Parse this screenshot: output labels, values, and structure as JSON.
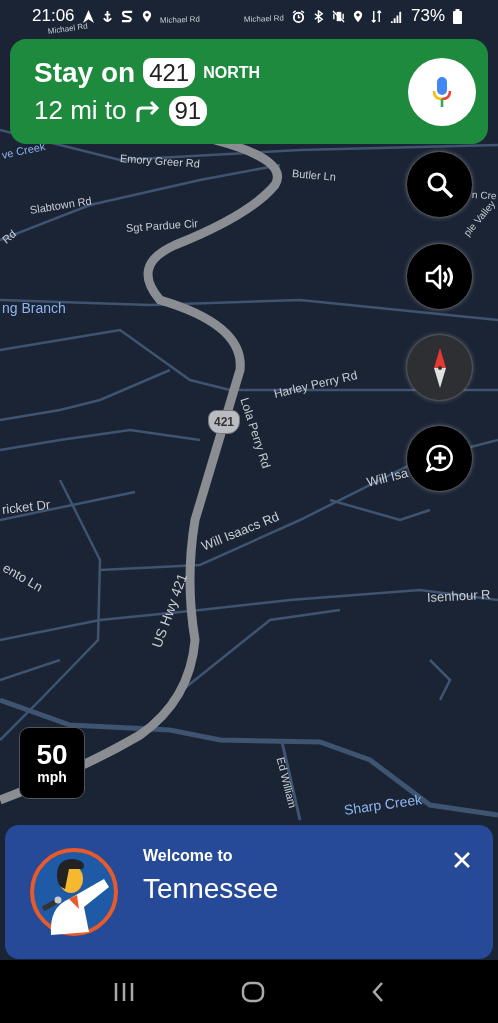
{
  "status_bar": {
    "time": "21:06",
    "battery": "73%"
  },
  "navigation": {
    "instruction": "Stay on",
    "route_shield": "421",
    "direction": "NORTH",
    "distance": "12 mi to",
    "next_shield": "91"
  },
  "map": {
    "shield": "421",
    "labels": [
      {
        "text": "Michael Rd",
        "kind": "road"
      },
      {
        "text": "Michael Rd",
        "kind": "road"
      },
      {
        "text": "Michael Rd",
        "kind": "road"
      },
      {
        "text": "ve Creek",
        "kind": "water"
      },
      {
        "text": "Emory Greer Rd",
        "kind": "road"
      },
      {
        "text": "Butler Ln",
        "kind": "road"
      },
      {
        "text": "Slabtown Rd",
        "kind": "road"
      },
      {
        "text": "Rd",
        "kind": "road"
      },
      {
        "text": "Sgt Pardue Cir",
        "kind": "road"
      },
      {
        "text": "ng Branch",
        "kind": "water"
      },
      {
        "text": "n Cre",
        "kind": "road"
      },
      {
        "text": "ple Valley",
        "kind": "road"
      },
      {
        "text": "Lola Perry Rd",
        "kind": "road"
      },
      {
        "text": "Harley Perry Rd",
        "kind": "road"
      },
      {
        "text": "Will Isa",
        "kind": "road"
      },
      {
        "text": "ricket Dr",
        "kind": "road"
      },
      {
        "text": "Will Isaacs Rd",
        "kind": "road"
      },
      {
        "text": "ento Ln",
        "kind": "road"
      },
      {
        "text": "Isenhour R",
        "kind": "road"
      },
      {
        "text": "US Hwy 421",
        "kind": "road"
      },
      {
        "text": "Ed William",
        "kind": "road"
      },
      {
        "text": "Sharp Creek",
        "kind": "water"
      }
    ]
  },
  "speed_limit": {
    "value": "50",
    "unit": "mph"
  },
  "welcome": {
    "heading": "Welcome to",
    "place": "Tennessee"
  }
}
